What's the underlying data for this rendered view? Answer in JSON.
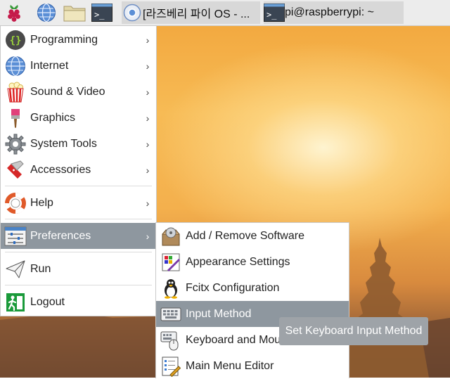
{
  "taskbar": {
    "launchers": [
      {
        "icon": "raspberry-icon"
      },
      {
        "icon": "globe-icon"
      },
      {
        "icon": "folder-icon"
      },
      {
        "icon": "terminal-icon"
      }
    ],
    "tasks": [
      {
        "icon": "chromium-icon",
        "label": "[라즈베리 파이 OS - ..."
      },
      {
        "icon": "terminal-icon",
        "label": "pi@raspberrypi: ~"
      }
    ]
  },
  "main_menu": {
    "items": [
      {
        "label": "Programming",
        "icon": "braces-icon",
        "has_submenu": true
      },
      {
        "label": "Internet",
        "icon": "globe-icon",
        "has_submenu": true
      },
      {
        "label": "Sound & Video",
        "icon": "popcorn-icon",
        "has_submenu": true
      },
      {
        "label": "Graphics",
        "icon": "paintbrush-icon",
        "has_submenu": true
      },
      {
        "label": "System Tools",
        "icon": "gear-icon",
        "has_submenu": true
      },
      {
        "label": "Accessories",
        "icon": "swiss-knife-icon",
        "has_submenu": true
      },
      {
        "label": "Help",
        "icon": "lifebuoy-icon",
        "has_submenu": true
      },
      {
        "label": "Preferences",
        "icon": "sliders-icon",
        "has_submenu": true,
        "selected": true
      },
      {
        "label": "Run",
        "icon": "paper-plane-icon",
        "has_submenu": false
      },
      {
        "label": "Logout",
        "icon": "exit-icon",
        "has_submenu": false
      }
    ]
  },
  "preferences_menu": {
    "items": [
      {
        "label": "Add / Remove Software",
        "icon": "package-icon"
      },
      {
        "label": "Appearance Settings",
        "icon": "palette-icon"
      },
      {
        "label": "Fcitx Configuration",
        "icon": "penguin-icon"
      },
      {
        "label": "Input Method",
        "icon": "keyboard-icon",
        "selected": true
      },
      {
        "label": "Keyboard and Mouse",
        "icon": "keyboard-mouse-icon"
      },
      {
        "label": "Main Menu Editor",
        "icon": "menu-editor-icon"
      }
    ]
  },
  "tooltip": {
    "text": "Set Keyboard Input Method"
  },
  "colors": {
    "selection": "#8e979f",
    "taskbar": "#ececec",
    "tooltip": "#9ea3a8"
  }
}
